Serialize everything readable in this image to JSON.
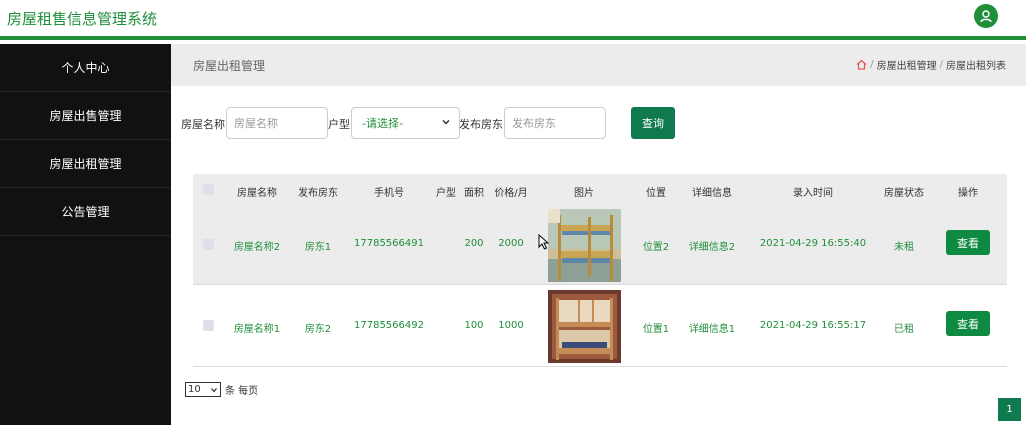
{
  "app": {
    "title": "房屋租售信息管理系统"
  },
  "icons": {
    "user": "user-icon",
    "home": "home-icon",
    "chevron": "chevron-down-icon",
    "cursor": "mouse-pointer-icon"
  },
  "colors": {
    "brand": "#1f8f3a",
    "button": "#0e7a4d",
    "sidebar": "#111111"
  },
  "sidebar": {
    "items": [
      {
        "label": "个人中心"
      },
      {
        "label": "房屋出售管理"
      },
      {
        "label": "房屋出租管理"
      },
      {
        "label": "公告管理"
      }
    ]
  },
  "page": {
    "title": "房屋出租管理",
    "breadcrumb": [
      "房屋出租管理",
      "房屋出租列表"
    ],
    "breadcrumb_sep": "/"
  },
  "search": {
    "name_label": "房屋名称",
    "name_placeholder": "房屋名称",
    "type_label": "户型",
    "type_selected": "-请选择-",
    "landlord_label": "发布房东",
    "landlord_placeholder": "发布房东",
    "query_label": "查询"
  },
  "table": {
    "headers": [
      "房屋名称",
      "发布房东",
      "手机号",
      "户型",
      "面积",
      "价格/月",
      "图片",
      "位置",
      "详细信息",
      "录入时间",
      "房屋状态",
      "操作"
    ],
    "rows": [
      {
        "name": "房屋名称2",
        "landlord": "房东1",
        "phone": "17785566491",
        "type": "",
        "area": "200",
        "price": "2000",
        "image": "bunk-bed-photo",
        "location": "位置2",
        "detail": "详细信息2",
        "time": "2021-04-29 16:55:40",
        "status": "未租",
        "action": "查看"
      },
      {
        "name": "房屋名称1",
        "landlord": "房东2",
        "phone": "17785566492",
        "type": "",
        "area": "100",
        "price": "1000",
        "image": "bunk-bed-photo",
        "location": "位置1",
        "detail": "详细信息1",
        "time": "2021-04-29 16:55:17",
        "status": "已租",
        "action": "查看"
      }
    ]
  },
  "pagination": {
    "page_size": "10",
    "page_size_suffix": "条 每页",
    "current_page": "1"
  }
}
